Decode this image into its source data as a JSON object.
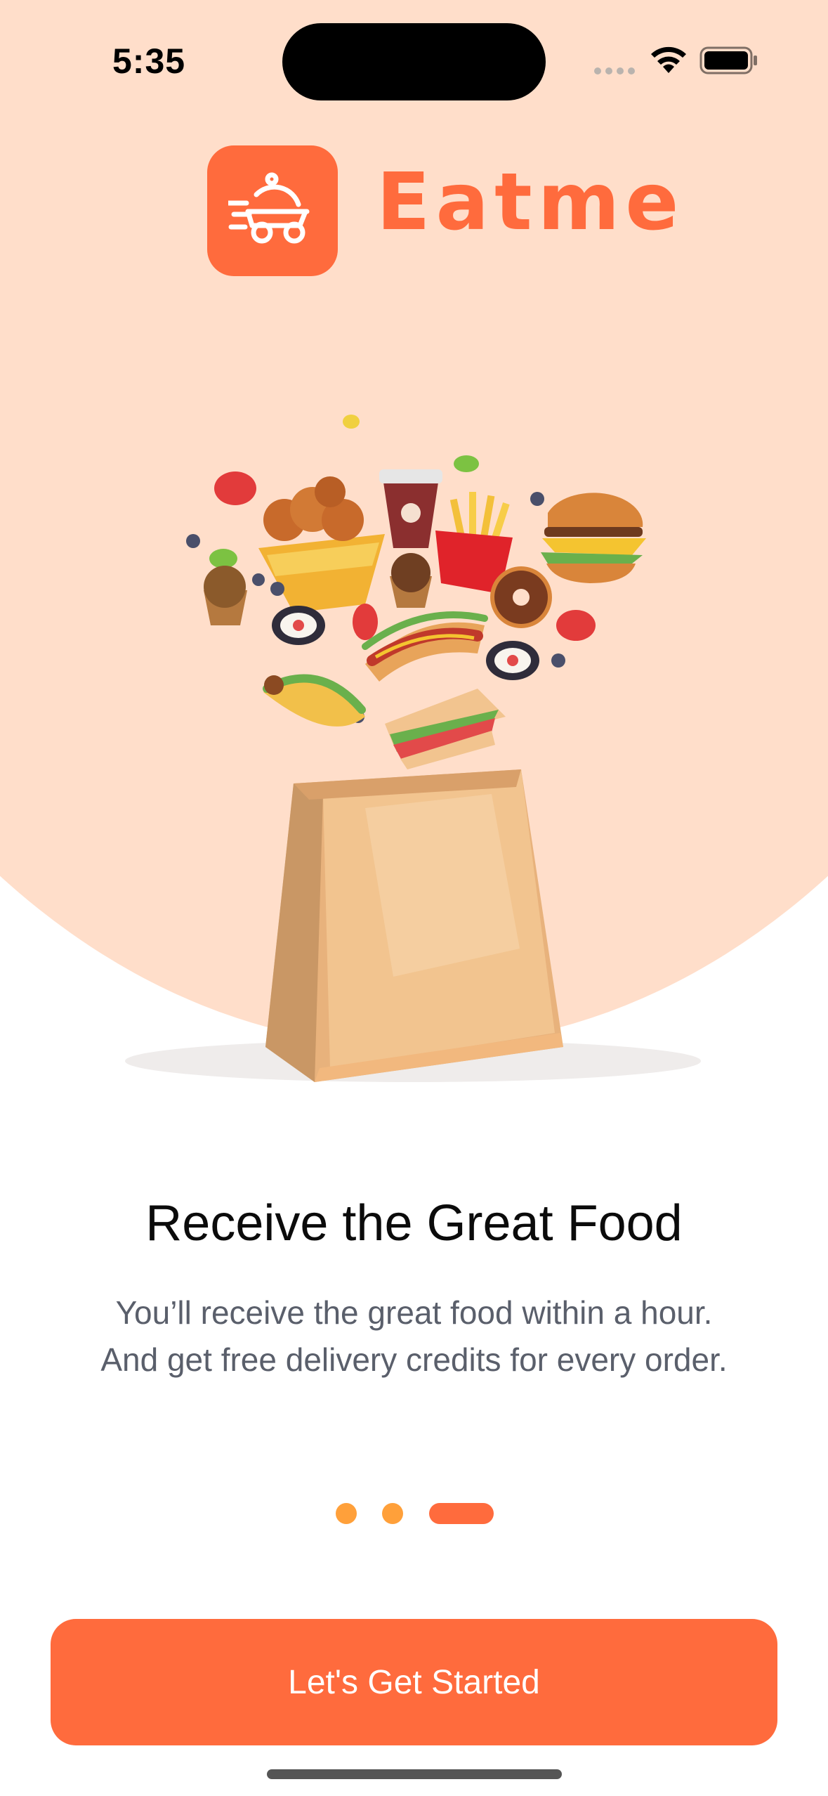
{
  "status_bar": {
    "time": "5:35",
    "icons": [
      "signal-icon",
      "wifi-icon",
      "battery-icon"
    ]
  },
  "brand": {
    "name": "Eatme",
    "logo_icon": "delivery-cloche-icon",
    "color": "#FF6B3D"
  },
  "illustration": {
    "name": "food-bag-illustration"
  },
  "onboarding": {
    "title": "Receive the Great Food",
    "subtitle_lines": [
      "You’ll receive the great food within a hour.",
      "And get free delivery credits for every order."
    ],
    "page_index": 3,
    "page_count": 3
  },
  "cta": {
    "label": "Let's Get Started"
  },
  "colors": {
    "hero_background": "#FFDECA",
    "accent": "#FF6B3D",
    "dot_inactive": "#FFA03A",
    "subtitle_text": "#5a5f6b"
  }
}
